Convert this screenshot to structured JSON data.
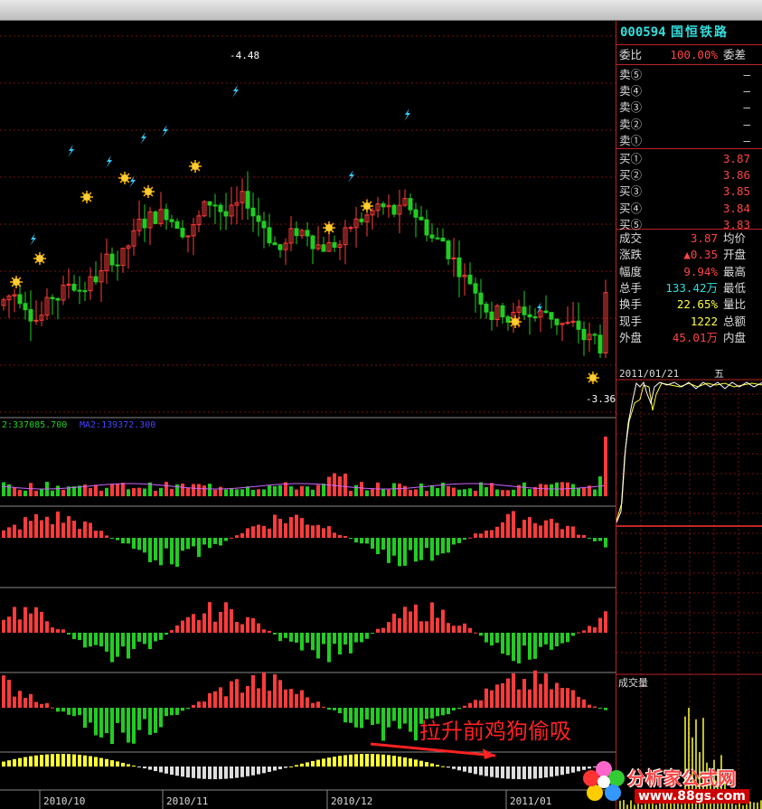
{
  "stock": {
    "code": "000594",
    "name": "国恒铁路"
  },
  "main_chart": {
    "max_label": "4.48",
    "min_label": "-3.36",
    "volume_readout": "2:337085.700",
    "volume_readout2": "MA2:139372.300",
    "annotation": "拉升前鸡狗偷吸",
    "xaxis": [
      "2010/10",
      "2010/11",
      "2010/12",
      "2011/01"
    ],
    "colors": {
      "up": "#ff3b3b",
      "down": "#22cc22",
      "grid": "#7a1010",
      "bg": "#000000"
    }
  },
  "quote": {
    "weibi": {
      "label": "委比",
      "value": "100.00%",
      "label2": "委差"
    },
    "sell": [
      {
        "label": "卖⑤",
        "price": "—"
      },
      {
        "label": "卖④",
        "price": "—"
      },
      {
        "label": "卖③",
        "price": "—"
      },
      {
        "label": "卖②",
        "price": "—"
      },
      {
        "label": "卖①",
        "price": "—"
      }
    ],
    "buy": [
      {
        "label": "买①",
        "price": "3.87"
      },
      {
        "label": "买②",
        "price": "3.86"
      },
      {
        "label": "买③",
        "price": "3.85"
      },
      {
        "label": "买④",
        "price": "3.84"
      },
      {
        "label": "买⑤",
        "price": "3.83"
      }
    ],
    "stats": [
      {
        "label": "成交",
        "value": "3.87",
        "label2": "均价"
      },
      {
        "label": "涨跌",
        "value": "▲0.35",
        "label2": "开盘"
      },
      {
        "label": "幅度",
        "value": "9.94%",
        "label2": "最高"
      },
      {
        "label": "总手",
        "value": "133.42万",
        "label2": "最低"
      },
      {
        "label": "换手",
        "value": "22.65%",
        "label2": "量比"
      },
      {
        "label": "现手",
        "value": "1222",
        "label2": "总额"
      },
      {
        "label": "外盘",
        "value": "45.01万",
        "label2": "内盘"
      }
    ]
  },
  "intraday": {
    "date": "2011/01/21",
    "weekday": "五",
    "volume_label": "成交量"
  },
  "watermark": {
    "text": "分析家公式网",
    "url": "www.88gs.com"
  }
}
